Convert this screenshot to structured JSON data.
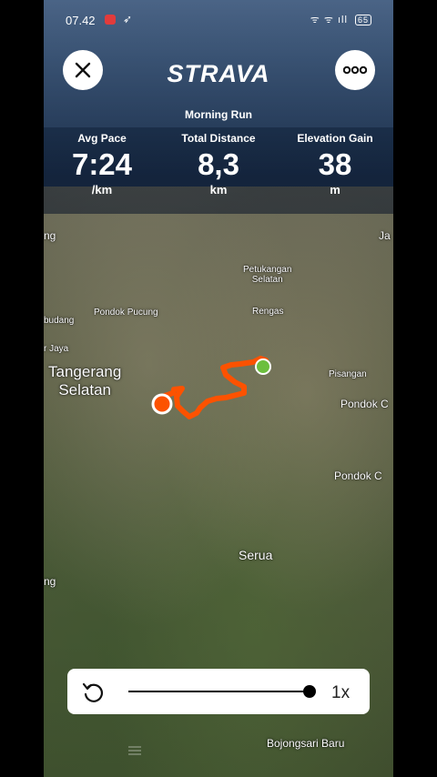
{
  "status_bar": {
    "time": "07.42",
    "right": "ᯤ ᯤ ıll",
    "battery": "65"
  },
  "header": {
    "logo": "STRAVA",
    "activity_title": "Morning Run"
  },
  "stats": [
    {
      "label": "Avg Pace",
      "value": "7:24",
      "unit": "/km"
    },
    {
      "label": "Total Distance",
      "value": "8,3",
      "unit": "km"
    },
    {
      "label": "Elevation Gain",
      "value": "38",
      "unit": "m"
    }
  ],
  "map_labels": {
    "ng_top": "ng",
    "ja": "Ja",
    "petukangan": "Petukangan\nSelatan",
    "pondok_pucung": "Pondok Pucung",
    "rengas": "Rengas",
    "budang": "budang",
    "r_jaya": "r Jaya",
    "tangerang_selatan": "Tangerang\nSelatan",
    "pisangan": "Pisangan",
    "pondok_c1": "Pondok C",
    "pondok_c2": "Pondok C",
    "serua": "Serua",
    "ng_bottom": "ng",
    "bojongsari": "Bojongsari Baru"
  },
  "playback": {
    "speed": "1x",
    "progress": 1.0
  },
  "colors": {
    "route": "#fc5200",
    "start_marker": "#6cbf3e",
    "end_marker": "#fc5200"
  }
}
